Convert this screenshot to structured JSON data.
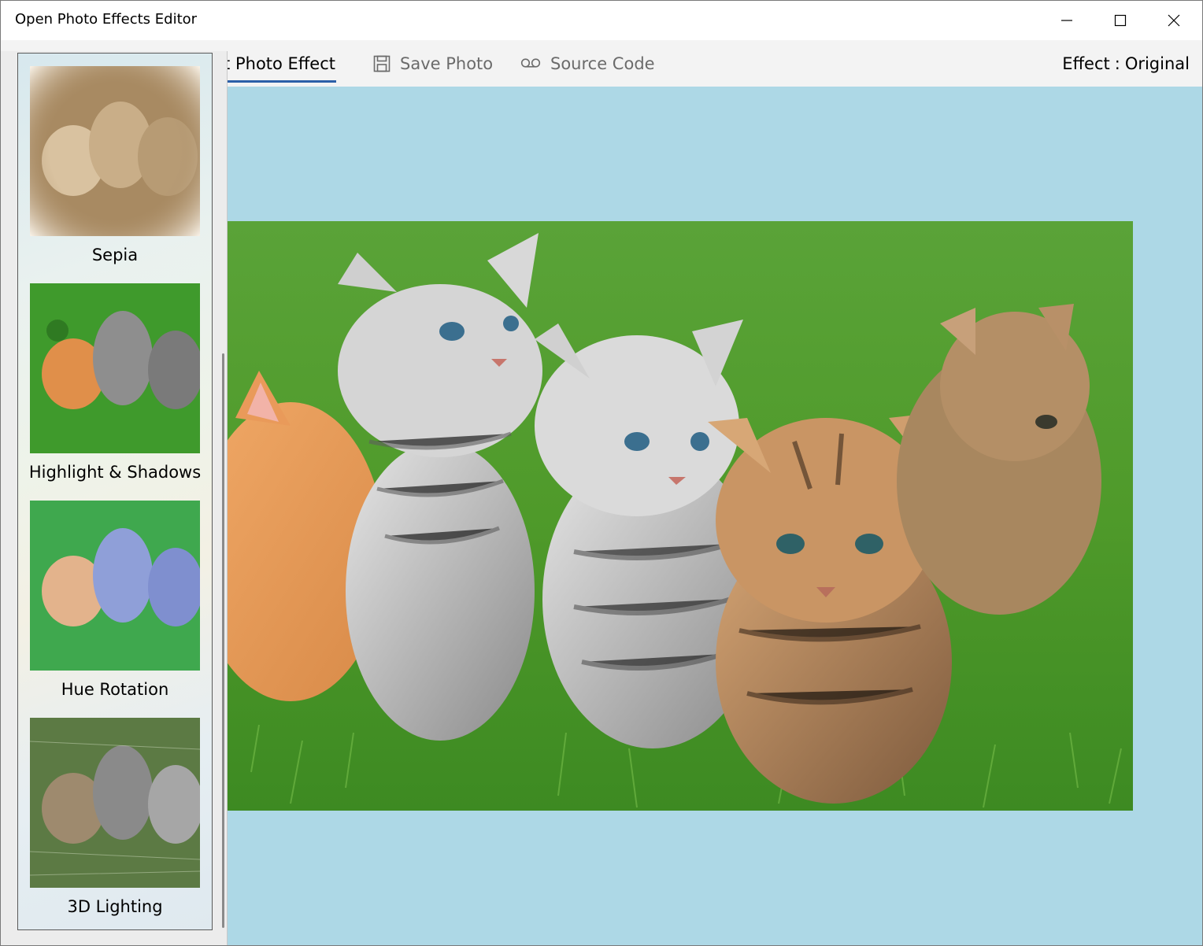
{
  "window": {
    "title": "Open Photo Effects Editor"
  },
  "commandbar": {
    "select_label": "ct Photo Effect",
    "save_label": "Save Photo",
    "source_label": "Source Code"
  },
  "status": {
    "effect_label": "Effect",
    "separator": ":",
    "effect_value": "Original"
  },
  "effects": [
    {
      "label": "Sepia",
      "icon": "sepia-thumbnail"
    },
    {
      "label": "Highlight & Shadows",
      "icon": "highlight-shadows-thumbnail"
    },
    {
      "label": "Hue Rotation",
      "icon": "hue-rotation-thumbnail"
    },
    {
      "label": "3D Lighting",
      "icon": "3d-lighting-thumbnail"
    }
  ],
  "colors": {
    "canvas_background": "#add8e6",
    "accent_underline": "#2b5fa8",
    "grass": "#4f9a2a"
  }
}
